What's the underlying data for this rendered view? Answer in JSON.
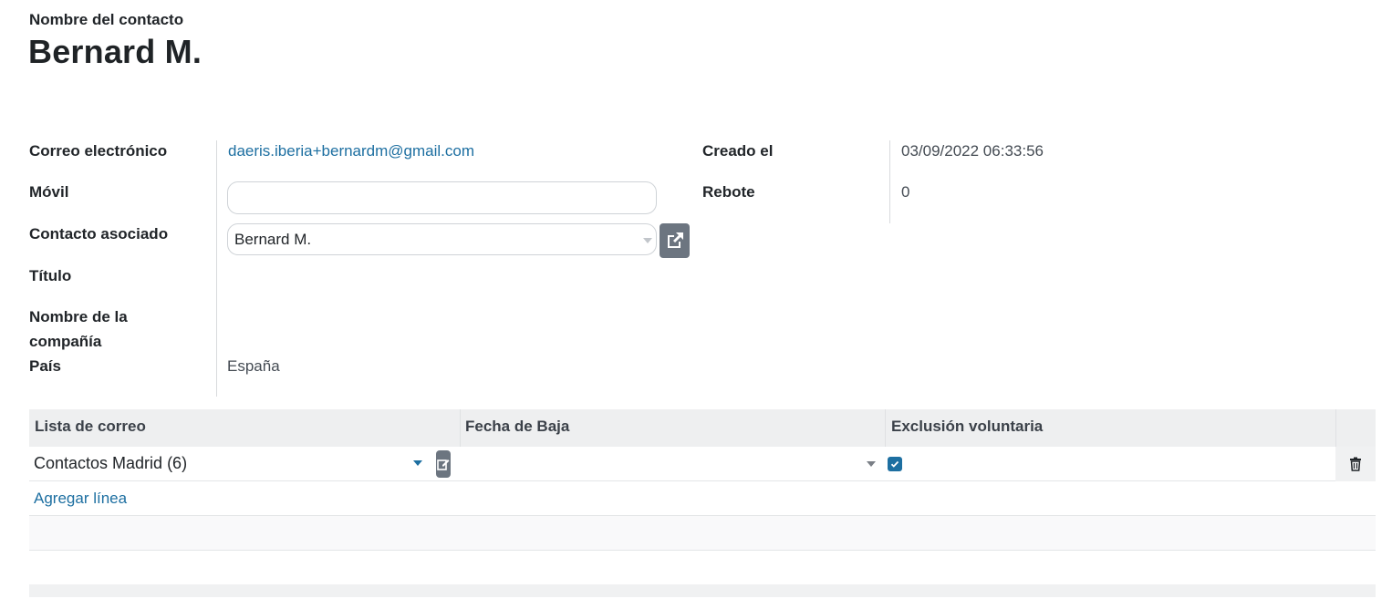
{
  "header": {
    "label": "Nombre del contacto",
    "name": "Bernard M."
  },
  "fields": {
    "email_label": "Correo electrónico",
    "email_value": "daeris.iberia+bernardm@gmail.com",
    "mobile_label": "Móvil",
    "mobile_value": "",
    "partner_label": "Contacto asociado",
    "partner_value": "Bernard M.",
    "title_label": "Título",
    "company_label_1": "Nombre de la",
    "company_label_2": "compañía",
    "country_label": "País",
    "country_value": "España",
    "created_label": "Creado el",
    "created_value": "03/09/2022 06:33:56",
    "bounce_label": "Rebote",
    "bounce_value": "0"
  },
  "table": {
    "columns": [
      "Lista de correo",
      "Fecha de Baja",
      "Exclusión voluntaria"
    ],
    "rows": [
      {
        "list": "Contactos Madrid (6)",
        "unsubscribe_date": "",
        "opt_out": true
      }
    ],
    "add_line_label": "Agregar línea"
  },
  "icons": {
    "external_link": "external-link-icon",
    "edit": "edit-icon",
    "trash": "trash-icon",
    "check": "check-icon",
    "caret": "caret-down-icon"
  },
  "colors": {
    "link": "#1d6fa1",
    "button": "#6c7580",
    "checkbox": "#1d6fa1"
  }
}
